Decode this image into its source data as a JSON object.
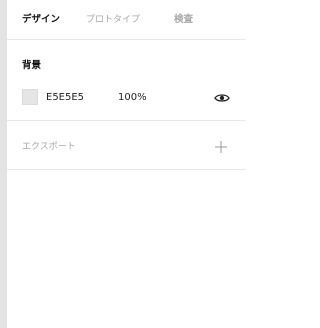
{
  "tabs": {
    "design": "デザイン",
    "prototype": "プロトタイプ",
    "inspect": "検査"
  },
  "background": {
    "title": "背景",
    "hex": "E5E5E5",
    "opacity": "100%",
    "swatch_color": "#E5E5E5",
    "visibility_icon": "eye-icon"
  },
  "export": {
    "label": "エクスポート",
    "add_icon": "plus-icon"
  }
}
